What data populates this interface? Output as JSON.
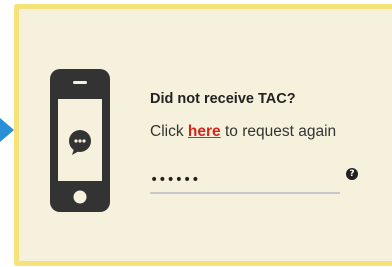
{
  "tac_help": {
    "heading": "Did not receive TAC?",
    "request_prefix": "Click",
    "request_link": "here",
    "request_suffix": "to request again"
  },
  "tac_input": {
    "value": "••••••"
  },
  "icons": {
    "phone": "smartphone-chat-icon",
    "help": "question-circle-icon",
    "pointer": "arrow-right-icon"
  },
  "colors": {
    "card_background": "#f6f1dc",
    "card_border": "#f5e37a",
    "link": "#d6261c",
    "pointer": "#2b8fd6"
  }
}
